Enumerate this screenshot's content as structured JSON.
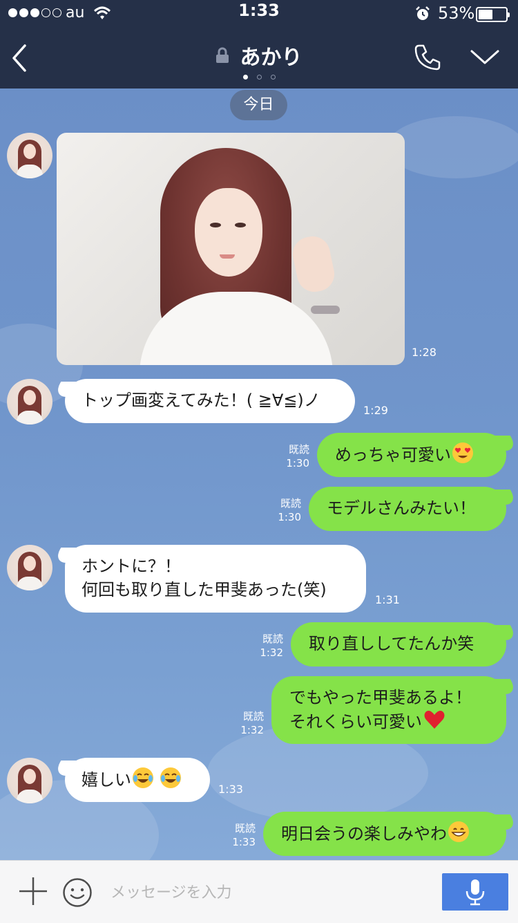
{
  "status": {
    "carrier": "au",
    "time": "1:33",
    "battery_percent": "53%",
    "battery_level": 0.53
  },
  "header": {
    "title": "あかり",
    "page_count": 3,
    "active_page": 0
  },
  "chat": {
    "date_label": "今日",
    "image_time": "1:28",
    "messages": [
      {
        "dir": "in",
        "text": "トップ画変えてみた！( ≧∀≦)ノ",
        "time": "1:29"
      },
      {
        "dir": "out",
        "text": "めっちゃ可愛い",
        "emoji": "heart-eyes-emoji",
        "read": "既読",
        "time": "1:30"
      },
      {
        "dir": "out",
        "text": "モデルさんみたい！",
        "read": "既読",
        "time": "1:30"
      },
      {
        "dir": "in",
        "line1": "ホントに？！",
        "line2": "何回も取り直した甲斐あった(笑)",
        "time": "1:31"
      },
      {
        "dir": "out",
        "text": "取り直ししてたんか笑",
        "read": "既読",
        "time": "1:32"
      },
      {
        "dir": "out",
        "line1": "でもやった甲斐あるよ！",
        "line2": "それくらい可愛い",
        "emoji": "red-heart-emoji",
        "read": "既読",
        "time": "1:32"
      },
      {
        "dir": "in",
        "text": "嬉しい",
        "emoji": "tears-of-joy-emoji",
        "time": "1:33"
      },
      {
        "dir": "out",
        "text": "明日会うの楽しみやわ",
        "emoji": "grinning-emoji",
        "read": "既読",
        "time": "1:33"
      }
    ]
  },
  "input": {
    "placeholder": "メッセージを入力"
  },
  "colors": {
    "header_bg": "#253048",
    "chat_bg": "#7095cb",
    "outgoing_bubble": "#85e249",
    "incoming_bubble": "#ffffff",
    "mic_button": "#4a7fe0"
  }
}
